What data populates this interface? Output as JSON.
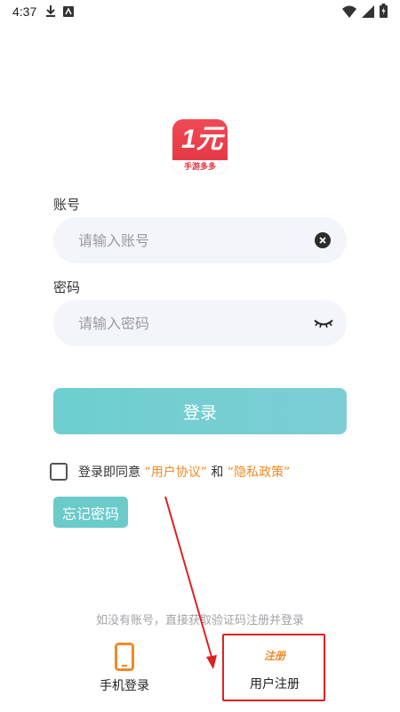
{
  "status_bar": {
    "time": "4:37",
    "icons_left": [
      "download-icon",
      "app-notification-icon"
    ],
    "icons_right": [
      "wifi-icon",
      "cellular-signal-icon",
      "battery-charging-icon"
    ]
  },
  "logo": {
    "main_text": "1元",
    "sub_text": "手游多多",
    "color": "#e23340"
  },
  "account": {
    "label": "账号",
    "placeholder": "请输入账号",
    "value": ""
  },
  "password": {
    "label": "密码",
    "placeholder": "请输入密码",
    "value": ""
  },
  "login_button": {
    "label": "登录",
    "color": "#72cfd2"
  },
  "agreement": {
    "prefix": "登录即同意",
    "user_agreement": "“用户协议”",
    "conjunction": "和",
    "privacy_policy": "“隐私政策”",
    "checked": false,
    "link_color": "#f08a24"
  },
  "forgot_password": {
    "label": "忘记密码"
  },
  "footer": {
    "hint": "如没有账号，直接获取验证码注册并登录",
    "phone_login_label": "手机登录",
    "register_icon_text": "注册",
    "register_label": "用户注册"
  },
  "annotation": {
    "color": "#e02020"
  }
}
